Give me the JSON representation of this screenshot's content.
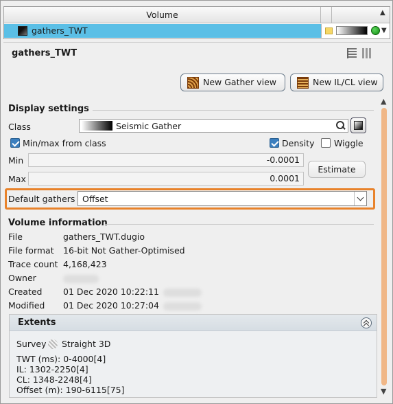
{
  "volume_table": {
    "column_header": "Volume",
    "rows": [
      {
        "name": "gathers_TWT",
        "status_color": "#1ea01e"
      }
    ]
  },
  "panel": {
    "title": "gathers_TWT",
    "icons": [
      "table-view-icon",
      "bar-chart-icon"
    ],
    "buttons": {
      "new_gather_view": "New Gather view",
      "new_ilcl_view": "New IL/CL view"
    }
  },
  "display_settings": {
    "heading": "Display settings",
    "class_label": "Class",
    "class_value": "Seismic Gather",
    "minmax_label": "Min/max from class",
    "minmax_checked": true,
    "density_label": "Density",
    "density_checked": true,
    "wiggle_label": "Wiggle",
    "wiggle_checked": false,
    "min_label": "Min",
    "min_value": "-0.0001",
    "max_label": "Max",
    "max_value": "0.0001",
    "estimate_label": "Estimate",
    "default_gathers_label": "Default gathers",
    "default_gathers_value": "Offset",
    "highlight_color": "#e8822a"
  },
  "volume_information": {
    "heading": "Volume information",
    "file_label": "File",
    "file_value": "gathers_TWT.dugio",
    "format_label": "File format",
    "format_value": "16-bit Not Gather-Optimised",
    "trace_count_label": "Trace count",
    "trace_count_value": "4,168,423",
    "owner_label": "Owner",
    "created_label": "Created",
    "created_value": "01 Dec 2020 10:22:11",
    "modified_label": "Modified",
    "modified_value": "01 Dec 2020 10:27:04"
  },
  "extents": {
    "heading": "Extents",
    "survey_label": "Survey",
    "survey_value": "Straight 3D",
    "twt": "TWT (ms): 0-4000[4]",
    "il": "IL: 1302-2250[4]",
    "cl": "CL: 1348-2248[4]",
    "offset": "Offset (m): 190-6115[75]"
  }
}
